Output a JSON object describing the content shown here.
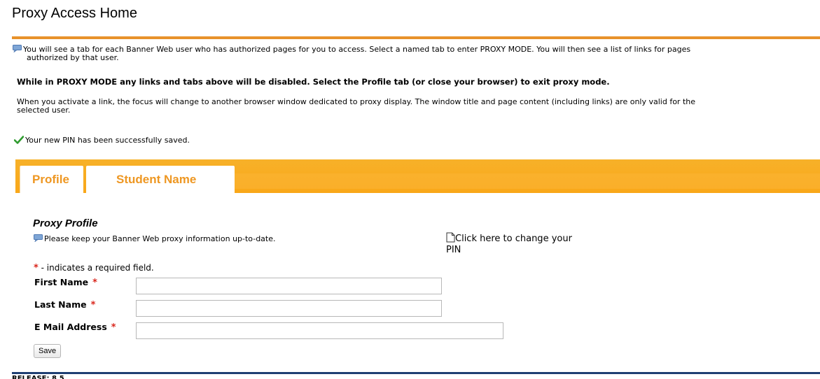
{
  "page": {
    "title": "Proxy Access Home"
  },
  "messages": {
    "info_line1": "You will see a tab for each Banner Web user who has authorized pages for you to access. Select a named tab to enter PROXY MODE. You will then see a list of links for pages",
    "info_line2": "authorized by that user.",
    "warning": "While in PROXY MODE any links and tabs above will be disabled. Select the Profile tab (or close your browser) to exit proxy mode.",
    "focus_line1": "When you activate a link, the focus will change to another browser window dedicated to proxy display. The window title and page content (including links) are only valid for the",
    "focus_line2": "selected user.",
    "success": "Your new PIN has been successfully saved."
  },
  "tabs": [
    {
      "label": "Profile"
    },
    {
      "label": "Student Name"
    }
  ],
  "profile": {
    "title": "Proxy Profile",
    "keep_note": "Please keep your Banner Web proxy information up-to-date.",
    "pin_link_line1": "Click here to change your",
    "pin_link_line2": "PIN",
    "required_note": " - indicates a required field.",
    "required_marker": "*",
    "fields": [
      {
        "label": "First Name",
        "value": ""
      },
      {
        "label": "Last Name",
        "value": ""
      },
      {
        "label": "E Mail Address",
        "value": ""
      }
    ],
    "save_label": "Save"
  },
  "footer": {
    "release": "RELEASE: 8.5"
  },
  "colors": {
    "accent_orange": "#e8922b",
    "tab_orange": "#f9a719",
    "tab_text": "#ee9722",
    "required_red": "#d9261c",
    "footer_navy": "#1f3f73"
  },
  "icons": {
    "info": "speech-bubble-icon",
    "success": "checkmark-icon",
    "document": "document-icon"
  }
}
